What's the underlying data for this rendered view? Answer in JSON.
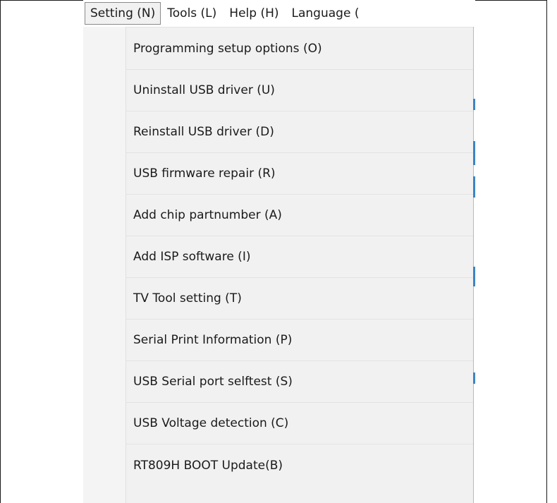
{
  "menubar": {
    "menus": [
      {
        "label": "Setting (N)"
      },
      {
        "label": "Tools (L)"
      },
      {
        "label": "Help (H)"
      },
      {
        "label": "Language ("
      }
    ]
  },
  "dropdown": {
    "items": [
      {
        "label": "Programming setup options (O)"
      },
      {
        "label": "Uninstall USB driver (U)"
      },
      {
        "label": "Reinstall USB driver (D)"
      },
      {
        "label": "USB firmware repair (R)"
      },
      {
        "label": "Add chip partnumber (A)"
      },
      {
        "label": "Add ISP software (I)"
      },
      {
        "label": "TV Tool setting (T)"
      },
      {
        "label": "Serial Print Information (P)"
      },
      {
        "label": "USB Serial port selftest (S)"
      },
      {
        "label": "USB Voltage detection (C)"
      },
      {
        "label": "RT809H BOOT Update(B)"
      }
    ]
  },
  "colors": {
    "menu_background": "#f1f1f1",
    "active_border": "#8a8a8a",
    "background_accent": "#3b84c8"
  }
}
